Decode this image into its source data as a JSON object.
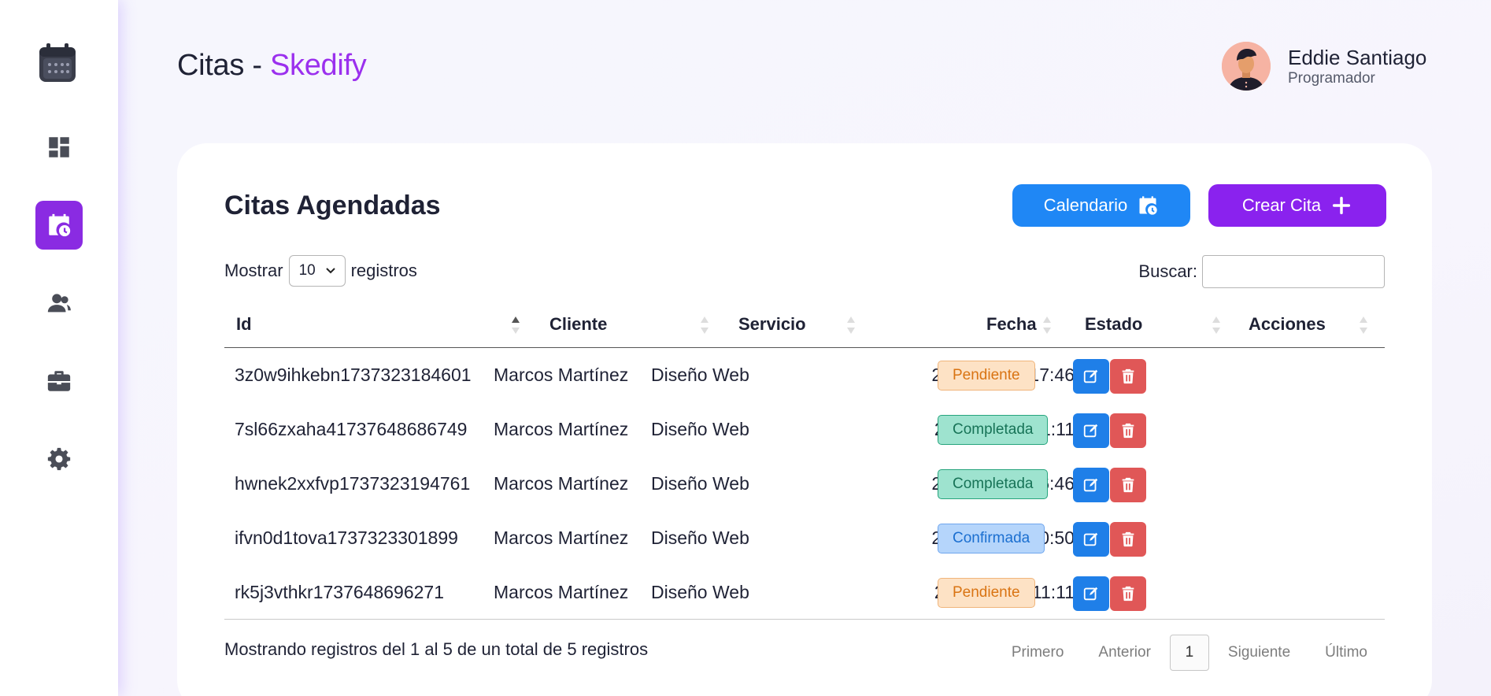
{
  "header": {
    "title_prefix": "Citas - ",
    "title_brand": "Skedify"
  },
  "user": {
    "name": "Eddie Santiago",
    "role": "Programador"
  },
  "sidebar": {
    "items": [
      {
        "name": "dashboard",
        "icon": "dashboard-icon",
        "active": false
      },
      {
        "name": "citas",
        "icon": "calendar-clock-icon",
        "active": true
      },
      {
        "name": "clientes",
        "icon": "users-icon",
        "active": false
      },
      {
        "name": "servicios",
        "icon": "briefcase-icon",
        "active": false
      },
      {
        "name": "ajustes",
        "icon": "gear-icon",
        "active": false
      }
    ]
  },
  "card": {
    "title": "Citas Agendadas",
    "btn_calendar": "Calendario",
    "btn_create": "Crear Cita"
  },
  "controls": {
    "show_label": "Mostrar",
    "show_value": "10",
    "show_suffix": "registros",
    "search_label": "Buscar:",
    "search_value": ""
  },
  "table": {
    "columns": [
      "Id",
      "Cliente",
      "Servicio",
      "Fecha",
      "Estado",
      "Acciones"
    ],
    "rows": [
      {
        "id": "3z0w9ihkebn1737323184601",
        "cliente": "Marcos Martínez",
        "servicio": "Diseño Web",
        "fecha": "2025-01-19 17:46",
        "estado": "Pendiente"
      },
      {
        "id": "7sl66zxaha41737648686749",
        "cliente": "Marcos Martínez",
        "servicio": "Diseño Web",
        "fecha": "2025-01-23 11:11",
        "estado": "Completada"
      },
      {
        "id": "hwnek2xxfvp1737323194761",
        "cliente": "Marcos Martínez",
        "servicio": "Diseño Web",
        "fecha": "2025-01-24 16:46",
        "estado": "Completada"
      },
      {
        "id": "ifvn0d1tova1737323301899",
        "cliente": "Marcos Martínez",
        "servicio": "Diseño Web",
        "fecha": "2025-02-12 10:50",
        "estado": "Confirmada"
      },
      {
        "id": "rk5j3vthkr1737648696271",
        "cliente": "Marcos Martínez",
        "servicio": "Diseño Web",
        "fecha": "2025-01-23 11:11",
        "estado": "Pendiente"
      }
    ]
  },
  "footer": {
    "info": "Mostrando registros del 1 al 5 de un total de 5 registros",
    "first": "Primero",
    "prev": "Anterior",
    "current": "1",
    "next": "Siguiente",
    "last": "Último"
  },
  "colors": {
    "accent": "#8a22ee",
    "brand_text": "#9b30ee",
    "calendar_button": "#1f87f5",
    "edit_button": "#1f7fe8",
    "delete_button": "#e05757"
  }
}
